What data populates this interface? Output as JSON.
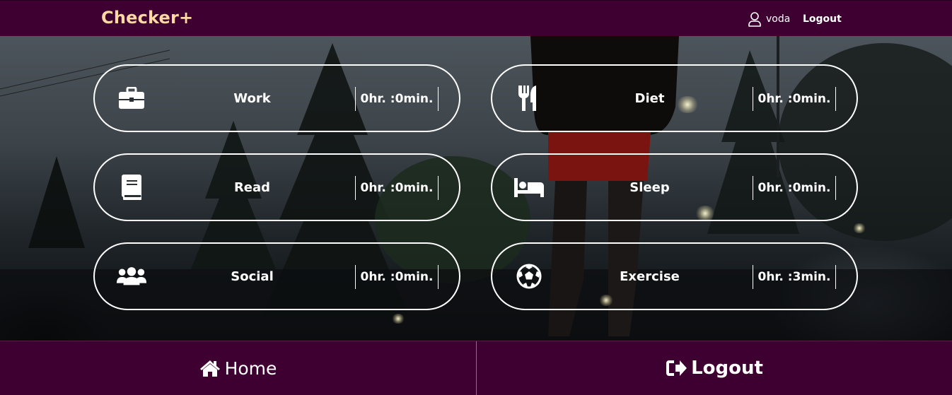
{
  "brand": {
    "title": "Checker+"
  },
  "nav": {
    "username": "voda",
    "logout_label": "Logout"
  },
  "activities": [
    {
      "label": "Work",
      "time": "0hr. :0min.",
      "icon": "briefcase-icon"
    },
    {
      "label": "Diet",
      "time": "0hr. :0min.",
      "icon": "utensils-icon"
    },
    {
      "label": "Read",
      "time": "0hr. :0min.",
      "icon": "book-icon"
    },
    {
      "label": "Sleep",
      "time": "0hr. :0min.",
      "icon": "bed-icon"
    },
    {
      "label": "Social",
      "time": "0hr. :0min.",
      "icon": "users-icon"
    },
    {
      "label": "Exercise",
      "time": "0hr. :3min.",
      "icon": "soccer-ball-icon"
    }
  ],
  "footer": {
    "home_label": "Home",
    "logout_label": "Logout"
  },
  "colors": {
    "navbar": "#3d0030",
    "brand": "#ffd9a3",
    "text": "#ffffff"
  }
}
